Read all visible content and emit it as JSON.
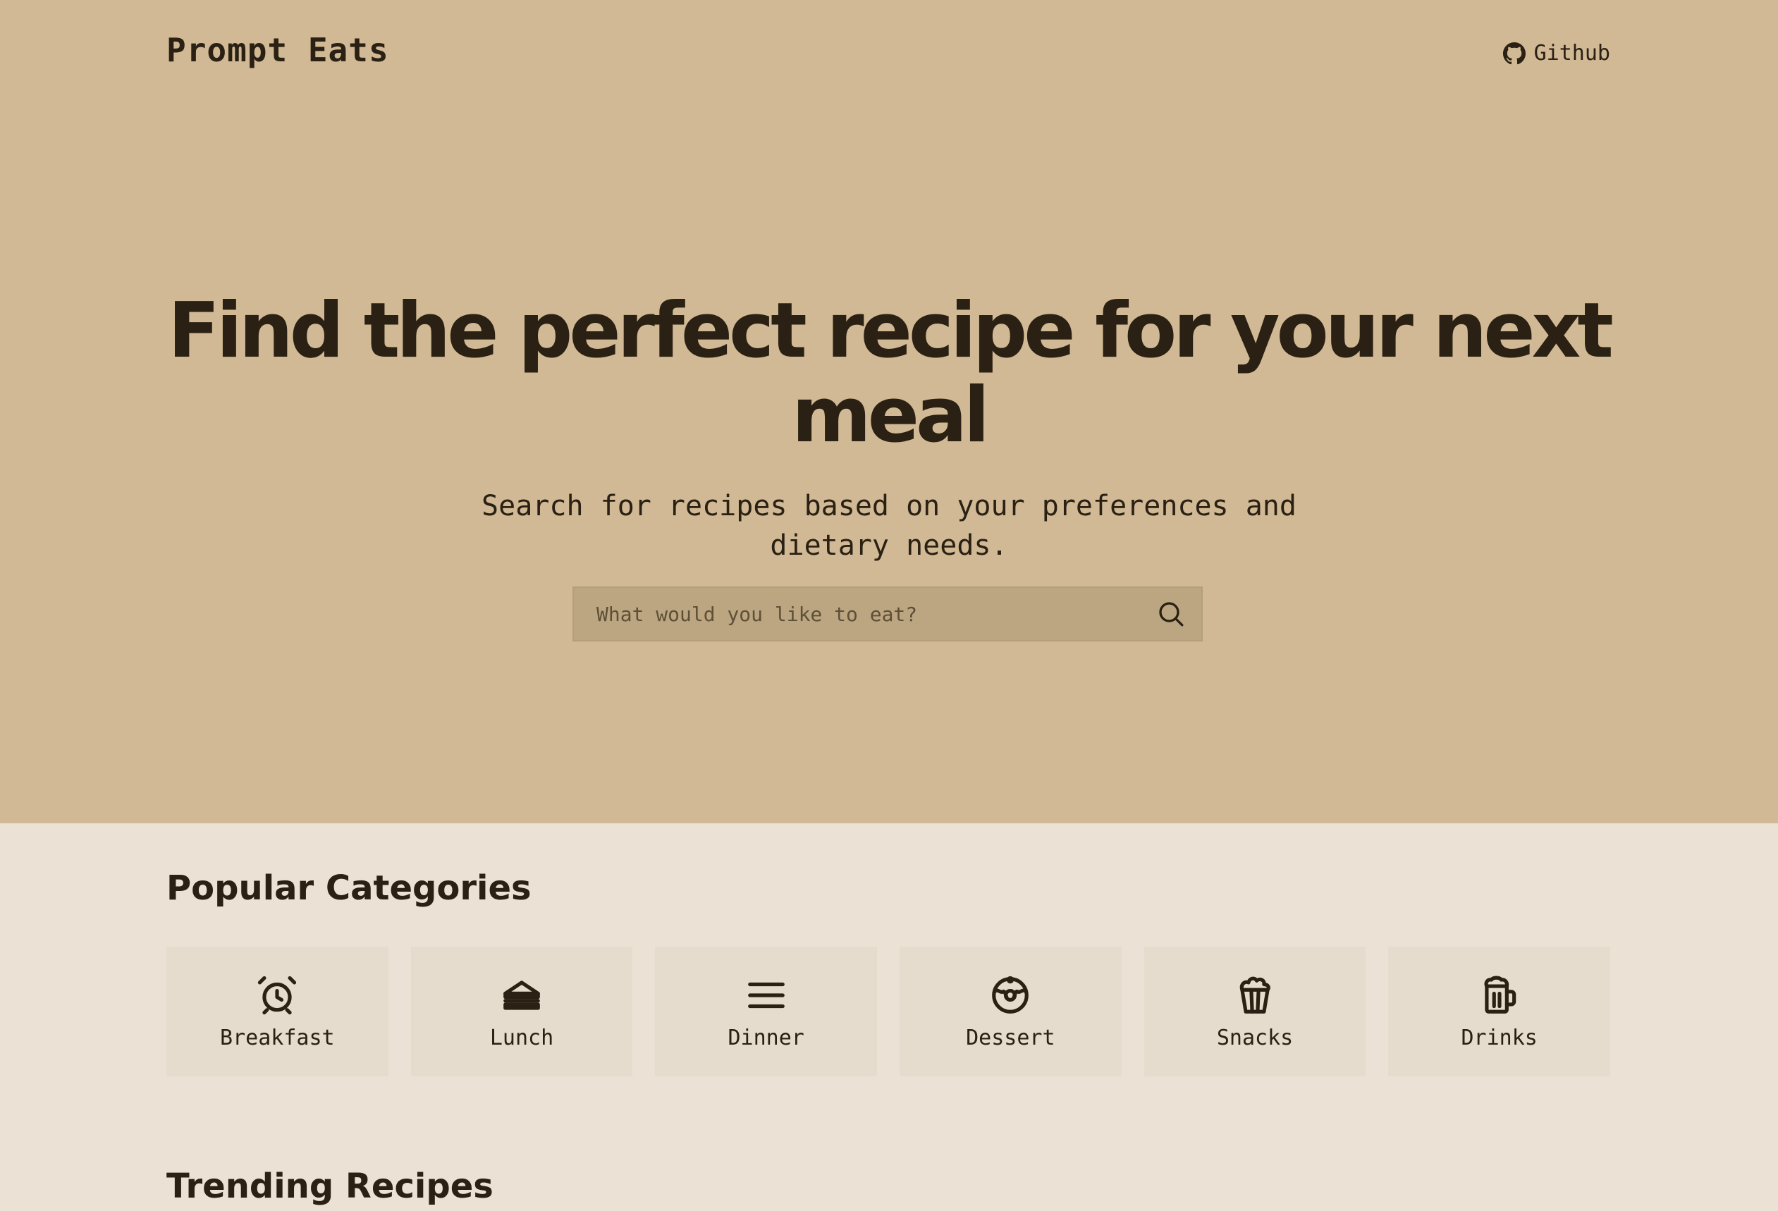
{
  "header": {
    "brand": "Prompt Eats",
    "github_label": "Github",
    "github_icon": "github-icon"
  },
  "hero": {
    "headline_line1": "Find the perfect recipe for your next",
    "headline_line2": "meal",
    "subhead_line1": "Search for recipes based on your preferences and",
    "subhead_line2": "dietary needs.",
    "search": {
      "placeholder": "What would you like to eat?",
      "value": "",
      "icon": "search-icon"
    }
  },
  "categories": {
    "title": "Popular Categories",
    "items": [
      {
        "label": "Breakfast",
        "icon": "alarm-clock-icon"
      },
      {
        "label": "Lunch",
        "icon": "sandwich-icon"
      },
      {
        "label": "Dinner",
        "icon": "menu-lines-icon"
      },
      {
        "label": "Dessert",
        "icon": "donut-icon"
      },
      {
        "label": "Snacks",
        "icon": "popcorn-icon"
      },
      {
        "label": "Drinks",
        "icon": "beer-mug-icon"
      }
    ]
  },
  "trending": {
    "title": "Trending Recipes"
  },
  "colors": {
    "hero_bg": "#d0b994",
    "page_bg": "#ebe2d5",
    "card_bg": "#e5dccd",
    "search_bg": "#bca681",
    "text": "#2a2013"
  }
}
